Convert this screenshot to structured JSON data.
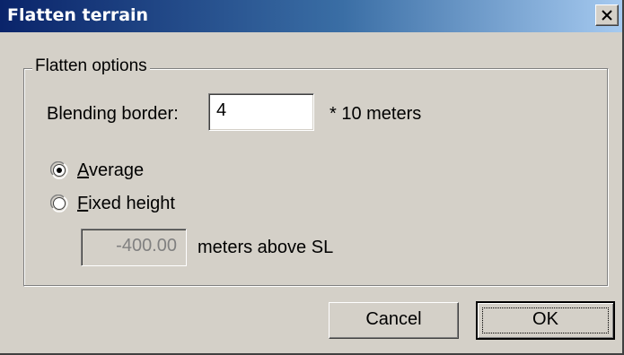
{
  "window": {
    "title": "Flatten terrain"
  },
  "group": {
    "legend": "Flatten options"
  },
  "blending": {
    "label": "Blending border:",
    "value": "4",
    "unit": "* 10 meters"
  },
  "mode": {
    "options": [
      {
        "accel": "A",
        "rest": "verage",
        "selected": true
      },
      {
        "accel": "F",
        "rest": "ixed height",
        "selected": false
      }
    ]
  },
  "height": {
    "value": "-400.00",
    "unit": "meters above SL"
  },
  "buttons": {
    "cancel": "Cancel",
    "ok": "OK"
  },
  "icons": {
    "close": "close-icon",
    "radio_selected": "radio-selected-icon",
    "radio_unselected": "radio-unselected-icon"
  }
}
